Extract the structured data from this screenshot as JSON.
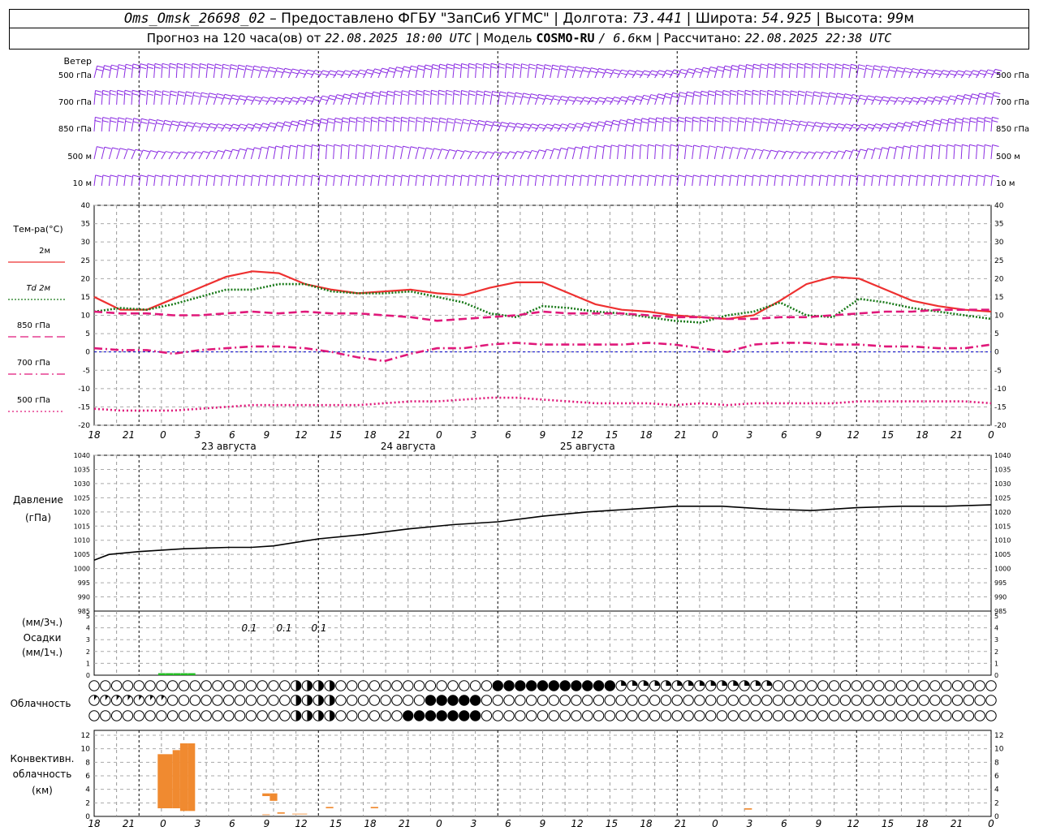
{
  "header": {
    "station": "Oms_Omsk_26698_02",
    "dash": "–",
    "provided_by": "Предоставлено ФГБУ \"ЗапСиб УГМС\"",
    "lon_label": "Долгота:",
    "lon": "73.441",
    "lat_label": "Широта:",
    "lat": "54.925",
    "alt_label": "Высота:",
    "alt": "99",
    "alt_unit": "м",
    "forecast_prefix": "Прогноз на 120 часа(ов) от",
    "forecast_time": "22.08.2025 18:00 UTC",
    "model_label": "Модель",
    "model_name": "COSMO-RU",
    "model_res": "/ 6.6",
    "model_res_unit": "км",
    "computed_label": "Рассчитано:",
    "computed_time": "22.08.2025 22:38 UTC",
    "sep": "|"
  },
  "colors": {
    "wind": "#8a2be2",
    "t2m": "#ee3030",
    "td2m": "#1a7a1a",
    "t850": "#e0187a",
    "t700": "#e0187a",
    "t500": "#e0187a",
    "pressure": "#000000",
    "precip": "#22bb22",
    "convective": "#f08a30"
  },
  "wind_panel": {
    "title": "Ветер",
    "levels": [
      "500 гПа",
      "700 гПа",
      "850 гПа",
      "500 м",
      "10 м"
    ]
  },
  "temp_panel": {
    "title": "Тем-ра(°С)",
    "legend": [
      {
        "label": "2м",
        "style": "solid"
      },
      {
        "label": "Td 2м",
        "style": "dotted"
      },
      {
        "label": "850 гПа",
        "style": "dashed"
      },
      {
        "label": "700 гПа",
        "style": "dashdot"
      },
      {
        "label": "500 гПа",
        "style": "finedot"
      }
    ],
    "yticks": [
      40,
      35,
      30,
      25,
      20,
      15,
      10,
      5,
      0,
      -5,
      -10,
      -15,
      -20
    ]
  },
  "time_axis": {
    "hour_labels": [
      "18",
      "21",
      "0",
      "3",
      "6",
      "9",
      "12",
      "15",
      "18",
      "21",
      "0",
      "3",
      "6",
      "9",
      "12",
      "15",
      "18",
      "21",
      "0",
      "3",
      "6",
      "9",
      "12",
      "15",
      "18",
      "21",
      "0"
    ],
    "day_labels": [
      "23 августа",
      "24 августа",
      "25 августа"
    ]
  },
  "pressure_panel": {
    "title": "Давление",
    "unit": "(гПа)",
    "yticks": [
      1040,
      1035,
      1030,
      1025,
      1020,
      1015,
      1010,
      1005,
      1000,
      995,
      990,
      985
    ]
  },
  "precip_panel": {
    "unit3": "(мм/3ч.)",
    "title": "Осадки",
    "unit1": "(мм/1ч.)",
    "yticks": [
      5,
      4,
      3,
      2,
      1,
      0
    ],
    "labels": [
      "0.1",
      "0.1",
      "0.1"
    ]
  },
  "cloud_panel": {
    "title": "Облачность"
  },
  "conv_panel": {
    "title1": "Конвективн.",
    "title2": "облачность",
    "unit": "(км)",
    "yticks": [
      12,
      10,
      8,
      6,
      4,
      2,
      0
    ]
  },
  "chart_data": [
    {
      "type": "line",
      "title": "Тем-ра(°С)",
      "x_hours": [
        0,
        6,
        9,
        12,
        15,
        18,
        21,
        24,
        27,
        30,
        33,
        36,
        39,
        42,
        45,
        48,
        51,
        54,
        57,
        60,
        63,
        66,
        69,
        72,
        75,
        78,
        81,
        84,
        87,
        90,
        93,
        96,
        99,
        102,
        105,
        108,
        111,
        114,
        117,
        120
      ],
      "ylim": [
        -20,
        40
      ],
      "series": [
        {
          "name": "2м",
          "values": [
            15,
            11.5,
            11.5,
            14.5,
            17.5,
            20.5,
            22,
            21.5,
            18.5,
            17,
            16,
            16.5,
            17,
            16,
            15.5,
            17.5,
            19,
            19,
            16,
            13,
            11.5,
            11,
            10,
            9.5,
            9,
            10,
            14,
            18.5,
            20.5,
            20,
            17,
            14,
            12.5,
            11.5,
            11
          ]
        },
        {
          "name": "Td 2м",
          "values": [
            11,
            12,
            11.5,
            13,
            15,
            17,
            17,
            18.5,
            18.5,
            16.5,
            16,
            16,
            16.5,
            15,
            13.5,
            10.5,
            9.5,
            12.5,
            12,
            11,
            10.5,
            9.5,
            8.5,
            8,
            10,
            11,
            13.5,
            10,
            9.5,
            14.5,
            13.5,
            12,
            11,
            10,
            9
          ]
        },
        {
          "name": "850 гПа",
          "values": [
            11,
            10.5,
            10.5,
            10,
            10,
            10.5,
            11,
            10.5,
            11,
            10.5,
            10.5,
            10,
            9.5,
            8.5,
            9,
            9.5,
            10,
            11,
            10.5,
            10.5,
            10.5,
            10,
            9.5,
            9.5,
            9,
            9,
            9.5,
            9.5,
            10,
            10.5,
            11,
            11,
            11.5,
            11.5,
            11.5
          ]
        },
        {
          "name": "700 гПа",
          "values": [
            1,
            0.5,
            0.5,
            -0.5,
            0.5,
            1,
            1.5,
            1.5,
            1,
            0,
            -1.5,
            -2.5,
            -0.5,
            1,
            1,
            2,
            2.5,
            2,
            2,
            2,
            2,
            2.5,
            2,
            1,
            0,
            2,
            2.5,
            2.5,
            2,
            2,
            1.5,
            1.5,
            1,
            1,
            2
          ]
        },
        {
          "name": "500 гПа",
          "values": [
            -15.5,
            -16,
            -16,
            -16,
            -15.5,
            -15,
            -14.5,
            -14.5,
            -14.5,
            -14.5,
            -14.5,
            -14,
            -13.5,
            -13.5,
            -13,
            -12.5,
            -12.5,
            -13,
            -13.5,
            -14,
            -14,
            -14,
            -14.5,
            -14,
            -14.5,
            -14,
            -14,
            -14,
            -14,
            -13.5,
            -13.5,
            -13.5,
            -13.5,
            -13.5,
            -14
          ]
        }
      ]
    },
    {
      "type": "line",
      "title": "Давление",
      "ylabel": "(гПа)",
      "x_hours": [
        0,
        2,
        6,
        12,
        18,
        21,
        24,
        30,
        36,
        42,
        48,
        54,
        60,
        66,
        72,
        78,
        84,
        90,
        96,
        102,
        108,
        114,
        120
      ],
      "ylim": [
        985,
        1040
      ],
      "series": [
        {
          "name": "Давление",
          "values": [
            1003,
            1005,
            1006,
            1007,
            1007.5,
            1007.5,
            1008,
            1010.5,
            1012,
            1014,
            1015.5,
            1016.5,
            1018.5,
            1020,
            1021,
            1022,
            1022,
            1021,
            1020.5,
            1021.5,
            1022,
            1022,
            1022.5
          ]
        }
      ]
    },
    {
      "type": "bar",
      "title": "Осадки",
      "x_hours": [
        9,
        10,
        11,
        12,
        13
      ],
      "ylim": [
        0,
        5
      ],
      "values": [
        0.1,
        0.1,
        0.1,
        0.1,
        0.1
      ],
      "annotations": [
        "0.1",
        "0.1",
        "0.1"
      ]
    },
    {
      "type": "bar",
      "title": "Конвективн. облачность",
      "ylabel": "(км)",
      "ylim": [
        0,
        12
      ],
      "bars": [
        {
          "h1": 8.5,
          "h2": 10.5,
          "bottom": 1.2,
          "top": 9.2
        },
        {
          "h1": 10.5,
          "h2": 11.5,
          "bottom": 1.2,
          "top": 9.8
        },
        {
          "h1": 11.5,
          "h2": 12.5,
          "bottom": 0.8,
          "top": 10.8
        },
        {
          "h1": 12.5,
          "h2": 13.5,
          "bottom": 0.8,
          "top": 10.8
        },
        {
          "h1": 22.5,
          "h2": 23.5,
          "bottom": 3.0,
          "top": 3.4
        },
        {
          "h1": 22.5,
          "h2": 23.5,
          "bottom": 0.2,
          "top": 0.3
        },
        {
          "h1": 23.5,
          "h2": 24.5,
          "bottom": 2.3,
          "top": 3.4
        },
        {
          "h1": 24.5,
          "h2": 25.5,
          "bottom": 0.4,
          "top": 0.6
        },
        {
          "h1": 26.5,
          "h2": 28.5,
          "bottom": 0.3,
          "top": 0.4
        },
        {
          "h1": 31.0,
          "h2": 32.0,
          "bottom": 1.2,
          "top": 1.4
        },
        {
          "h1": 37.0,
          "h2": 38.0,
          "bottom": 1.2,
          "top": 1.4
        },
        {
          "h1": 87.0,
          "h2": 88.0,
          "bottom": 1.0,
          "top": 1.2
        }
      ]
    }
  ]
}
